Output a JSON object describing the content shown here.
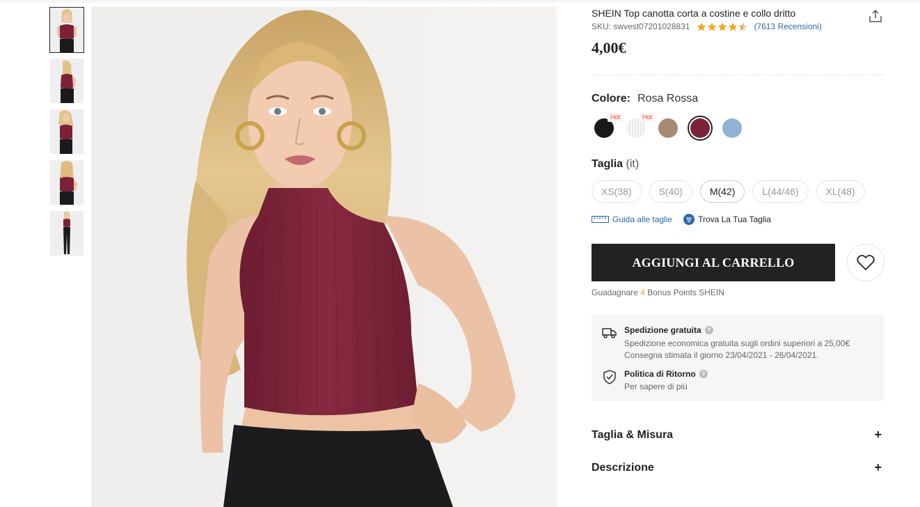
{
  "product": {
    "title": "SHEIN Top canotta corta a costine e collo dritto",
    "sku": "SKU: swvest07201028831",
    "rating": 4.5,
    "reviews": "(7613 Recensioni)",
    "price": "4,00€"
  },
  "thumbnails": [
    {
      "name": "front",
      "active": true
    },
    {
      "name": "side",
      "active": false
    },
    {
      "name": "front-2",
      "active": false
    },
    {
      "name": "back",
      "active": false
    },
    {
      "name": "full",
      "active": false
    }
  ],
  "color": {
    "label": "Colore:",
    "selected": "Rosa Rossa",
    "swatches": [
      {
        "color": "#1a1a1a",
        "badge": "Hot",
        "selected": false
      },
      {
        "color": "#e9e9e9",
        "badge": "Hot",
        "selected": false
      },
      {
        "color": "#a78a72",
        "badge": "",
        "selected": false
      },
      {
        "color": "#7b2238",
        "badge": "",
        "selected": true
      },
      {
        "color": "#8fb3d4",
        "badge": "",
        "selected": false
      }
    ]
  },
  "size": {
    "label": "Taglia",
    "unit": "(it)",
    "options": [
      "XS(38)",
      "S(40)",
      "M(42)",
      "L(44/46)",
      "XL(48)"
    ],
    "selected": "M(42)",
    "guide_label": "Guida alle taglie",
    "find_label": "Trova La Tua Taglia"
  },
  "actions": {
    "add_to_cart": "AGGIUNGI AL CARRELLO"
  },
  "points": {
    "prefix": "Guadagnare",
    "value": "4",
    "suffix": "Bonus Points SHEIN"
  },
  "shipping": {
    "title": "Spedizione gratuita",
    "line1": "Spedizione economica gratuita sugli ordini superiori a 25,00€",
    "line2": "Consegna stimata il giorno 23/04/2021 - 26/04/2021.",
    "returns_title": "Politica di Ritorno",
    "returns_link": "Per sapere di più",
    "help_glyph": "?"
  },
  "accordion": [
    {
      "label": "Taglia & Misura",
      "toggle": "+"
    },
    {
      "label": "Descrizione",
      "toggle": "+"
    }
  ],
  "colors": {
    "accent_link": "#2d68a8",
    "star": "#f5a623",
    "top_fabric": "#7b2238",
    "button": "#222222"
  }
}
